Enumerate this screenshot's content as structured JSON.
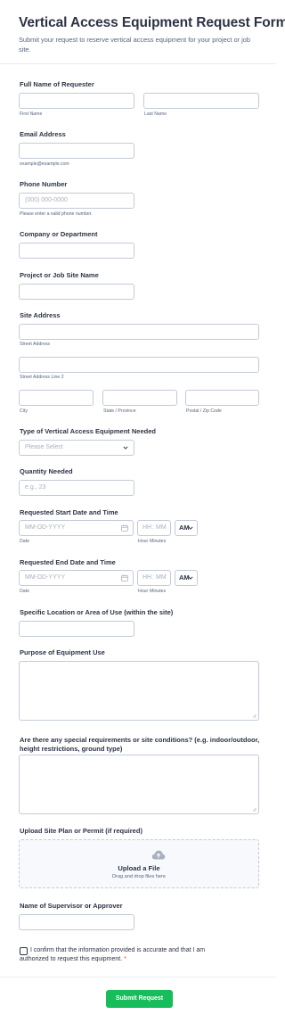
{
  "header": {
    "title": "Vertical Access Equipment Request Form",
    "subtitle": "Submit your request to reserve vertical access equipment for your project or job site."
  },
  "full_name": {
    "label": "Full Name of Requester",
    "first_sub": "First Name",
    "last_sub": "Last Name"
  },
  "email": {
    "label": "Email Address",
    "sub": "example@example.com"
  },
  "phone": {
    "label": "Phone Number",
    "placeholder": "(000) 000-0000",
    "sub": "Please enter a valid phone number."
  },
  "company": {
    "label": "Company or Department"
  },
  "project": {
    "label": "Project or Job Site Name"
  },
  "address": {
    "label": "Site Address",
    "street_sub": "Street Address",
    "street2_sub": "Street Address Line 2",
    "city_sub": "City",
    "state_sub": "State / Province",
    "zip_sub": "Postal / Zip Code"
  },
  "equipment_type": {
    "label": "Type of Vertical Access Equipment Needed",
    "selected": "Please Select"
  },
  "quantity": {
    "label": "Quantity Needed",
    "placeholder": "e.g., 23"
  },
  "start_date": {
    "label": "Requested Start Date and Time",
    "date_placeholder": "MM-DD-YYYY",
    "hh": "HH",
    "mm": "MM",
    "colon": ":",
    "ampm": "AM",
    "date_sub": "Date",
    "hour_sub": "Hour",
    "minutes_sub": "Minutes"
  },
  "end_date": {
    "label": "Requested End Date and Time",
    "date_placeholder": "MM-DD-YYYY",
    "hh": "HH",
    "mm": "MM",
    "colon": ":",
    "ampm": "AM",
    "date_sub": "Date",
    "hour_sub": "Hour",
    "minutes_sub": "Minutes"
  },
  "location": {
    "label": "Specific Location or Area of Use (within the site)"
  },
  "purpose": {
    "label": "Purpose of Equipment Use"
  },
  "requirements": {
    "label": "Are there any special requirements or site conditions? (e.g. indoor/outdoor, height restrictions, ground type)"
  },
  "upload": {
    "label": "Upload Site Plan or Permit (if required)",
    "title": "Upload a File",
    "sub": "Drag and drop files here"
  },
  "supervisor": {
    "label": "Name of Supervisor or Approver"
  },
  "confirm": {
    "text": "I confirm that the information provided is accurate and that I am authorized to request this equipment.",
    "required_mark": "*"
  },
  "submit": {
    "label": "Submit Request"
  },
  "colors": {
    "accent": "#18bd5b",
    "text": "#2c3345",
    "border": "#c3cad8",
    "required": "#f23a3c"
  }
}
